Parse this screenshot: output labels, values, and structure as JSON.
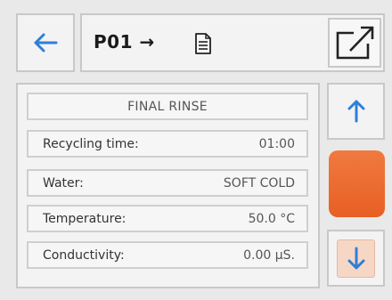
{
  "header": {
    "program": "P01",
    "arrow": "→",
    "back_icon": "arrow-left-icon",
    "doc_icon": "document-icon",
    "share_icon": "export-icon"
  },
  "main": {
    "section_title": "FINAL RINSE",
    "rows": [
      {
        "label": "Recycling time:",
        "value": "01:00"
      },
      {
        "label": "Water:",
        "value": "SOFT COLD"
      },
      {
        "label": "Temperature:",
        "value": "50.0 °C"
      },
      {
        "label": "Conductivity:",
        "value": "0.00 µS."
      }
    ]
  },
  "side": {
    "up_icon": "arrow-up-icon",
    "down_icon": "arrow-down-icon",
    "accent_color": "#ee6a2f",
    "arrow_color": "#2f7fd6"
  }
}
